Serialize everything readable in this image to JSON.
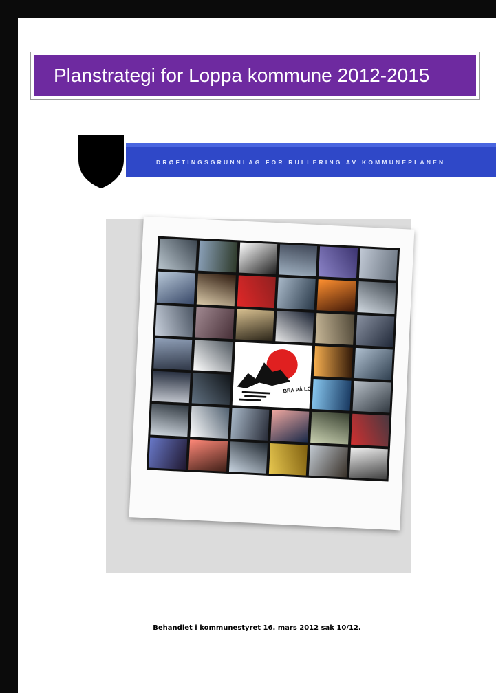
{
  "document": {
    "title": "Planstrategi for Loppa kommune 2012-2015",
    "subtitle_banner": "DRØFTINGSGRUNNLAG FOR RULLERING AV KOMMUNEPLANEN",
    "footer": "Behandlet i kommunestyret 16. mars 2012 sak 10/12.",
    "logo_caption": "BRA PÅ LOPPHAVET"
  },
  "colors": {
    "title_bar": "#6e2aa0",
    "banner": "#2f48c8",
    "shield": "#000000"
  },
  "icons": {
    "coat_of_arms": "shield-icon",
    "logo": "loppa-logo-icon"
  },
  "collage": {
    "tiles": [
      {
        "name": "photo-tile",
        "c1": "#b8c4cc",
        "c2": "#3c4650"
      },
      {
        "name": "photo-tile",
        "c1": "#8aa0b8",
        "c2": "#2e3a2a"
      },
      {
        "name": "photo-tile",
        "c1": "#ffffff",
        "c2": "#202020"
      },
      {
        "name": "photo-tile",
        "c1": "#9fb0c0",
        "c2": "#404858"
      },
      {
        "name": "photo-tile",
        "c1": "#8c84c8",
        "c2": "#3c3470"
      },
      {
        "name": "photo-tile",
        "c1": "#c0c8d4",
        "c2": "#6a7480"
      },
      {
        "name": "photo-tile",
        "c1": "#b8c8d8",
        "c2": "#384868"
      },
      {
        "name": "photo-tile",
        "c1": "#d8c8a8",
        "c2": "#301c10"
      },
      {
        "name": "photo-tile",
        "c1": "#e02828",
        "c2": "#902020"
      },
      {
        "name": "photo-tile",
        "c1": "#a8b8c8",
        "c2": "#283848"
      },
      {
        "name": "photo-tile",
        "c1": "#ff9030",
        "c2": "#401808"
      },
      {
        "name": "photo-tile",
        "c1": "#d0d8e0",
        "c2": "#404850"
      },
      {
        "name": "photo-tile",
        "c1": "#c8d0dc",
        "c2": "#4c5664"
      },
      {
        "name": "photo-tile",
        "c1": "#a08890",
        "c2": "#483038"
      },
      {
        "name": "photo-tile",
        "c1": "#d8c090",
        "c2": "#2a2418"
      },
      {
        "name": "photo-tile",
        "c1": "#e8e8e8",
        "c2": "#182030"
      },
      {
        "name": "photo-tile",
        "c1": "#c8b898",
        "c2": "#504838"
      },
      {
        "name": "photo-tile",
        "c1": "#8890a0",
        "c2": "#202838"
      },
      {
        "name": "photo-tile",
        "c1": "#90a0b8",
        "c2": "#303848"
      },
      {
        "name": "photo-tile",
        "c1": "#ffffff",
        "c2": "#505860"
      },
      {
        "name": "photo-tile",
        "c1": "#f8b050",
        "c2": "#301808"
      },
      {
        "name": "photo-tile",
        "c1": "#b0c0d0",
        "c2": "#304050"
      },
      {
        "name": "photo-tile",
        "c1": "#c0c4cc",
        "c2": "#283040"
      },
      {
        "name": "photo-tile",
        "c1": "#607080",
        "c2": "#101418"
      },
      {
        "name": "photo-tile",
        "c1": "#88c8f0",
        "c2": "#183860"
      },
      {
        "name": "photo-tile",
        "c1": "#b8c0c8",
        "c2": "#303840"
      },
      {
        "name": "photo-tile",
        "c1": "#d0d8e0",
        "c2": "#303840"
      },
      {
        "name": "photo-tile",
        "c1": "#ffffff",
        "c2": "#506070"
      },
      {
        "name": "photo-tile",
        "c1": "#a8b8c8",
        "c2": "#282c38"
      },
      {
        "name": "photo-tile",
        "c1": "#f0a8a0",
        "c2": "#182848"
      },
      {
        "name": "photo-tile",
        "c1": "#c8d0b0",
        "c2": "#384030"
      },
      {
        "name": "photo-tile",
        "c1": "#d03030",
        "c2": "#483840"
      },
      {
        "name": "photo-tile",
        "c1": "#6878c8",
        "c2": "#201830"
      },
      {
        "name": "photo-tile",
        "c1": "#ff8878",
        "c2": "#402018"
      },
      {
        "name": "photo-tile",
        "c1": "#c8d4e0",
        "c2": "#202830"
      },
      {
        "name": "photo-tile",
        "c1": "#e8c850",
        "c2": "#806010"
      },
      {
        "name": "photo-tile",
        "c1": "#c0c8d0",
        "c2": "#383028"
      },
      {
        "name": "photo-tile",
        "c1": "#f0f0f0",
        "c2": "#404040"
      }
    ]
  }
}
